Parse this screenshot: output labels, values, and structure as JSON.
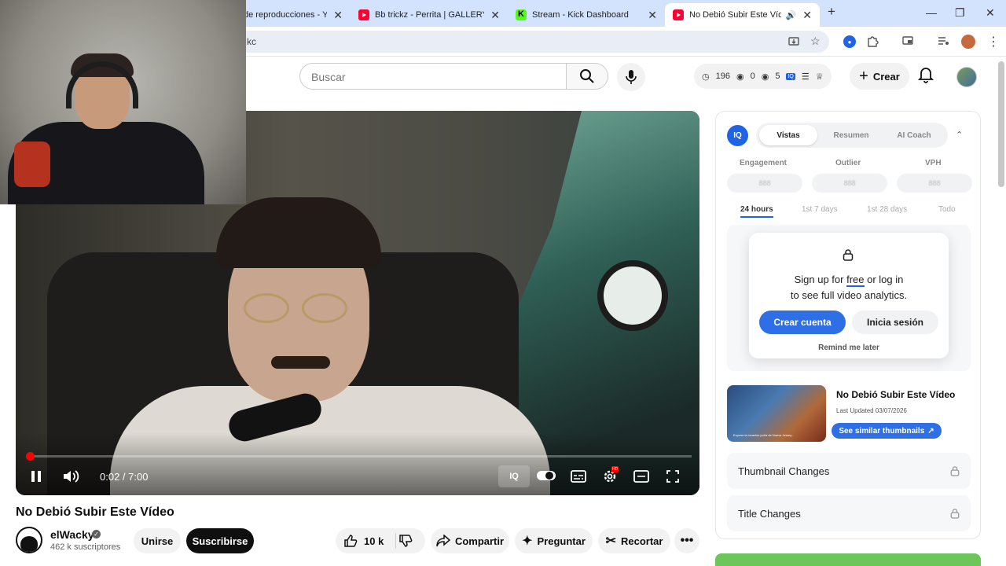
{
  "browser": {
    "tabs": [
      {
        "title": "de reproducciones - Yo",
        "icon": "youtube-icon"
      },
      {
        "title": "Bb trickz - Perrita | GALLERY SES",
        "icon": "youtube-icon"
      },
      {
        "title": "Stream - Kick Dashboard",
        "icon": "kick-icon"
      },
      {
        "title": "No Debió Subir Este Vídeo",
        "icon": "youtube-icon"
      }
    ],
    "url_fragment": "kc",
    "new_tab": "+",
    "close": "✕",
    "minimize": "—",
    "maximize": "❐"
  },
  "header": {
    "search_placeholder": "Buscar",
    "stat_views": "196",
    "stat_zero": "0",
    "stat_five": "5",
    "create_label": "Crear"
  },
  "player": {
    "time": "0:02 / 7:00",
    "progress": 0.005
  },
  "video": {
    "title": "No Debió Subir Este Vídeo",
    "channel": "elWacky",
    "subscribers": "462 k suscriptores",
    "join": "Unirse",
    "subscribe": "Suscribirse",
    "likes": "10 k",
    "share": "Compartir",
    "ask": "Preguntar",
    "clip": "Recortar"
  },
  "panel": {
    "tabs": [
      "Vistas",
      "Resumen",
      "AI Coach"
    ],
    "metrics": [
      "Engagement",
      "Outlier",
      "VPH"
    ],
    "metric_placeholder": "888",
    "ranges": [
      "24 hours",
      "1st 7 days",
      "1st 28 days",
      "Todo"
    ],
    "lock_msg_a": "Sign up for ",
    "lock_msg_free": "free",
    "lock_msg_b": " or log in",
    "lock_msg_c": "to see full video analytics.",
    "create_account": "Crear cuenta",
    "login": "Inicia sesión",
    "remind": "Remind me later",
    "video_title": "No Debió Subir Este Vídeo",
    "last_updated": "Last Updated 03/07/2026",
    "similar": "See similar thumbnails",
    "thumb_caption": "Expuse la invasión judía de Nueva Jersey...",
    "thumbnail_changes": "Thumbnail Changes",
    "title_changes": "Title Changes"
  },
  "colors": {
    "accent_blue": "#2e6fe6",
    "youtube_red": "#ff0033",
    "kick_green": "#53fc18"
  }
}
